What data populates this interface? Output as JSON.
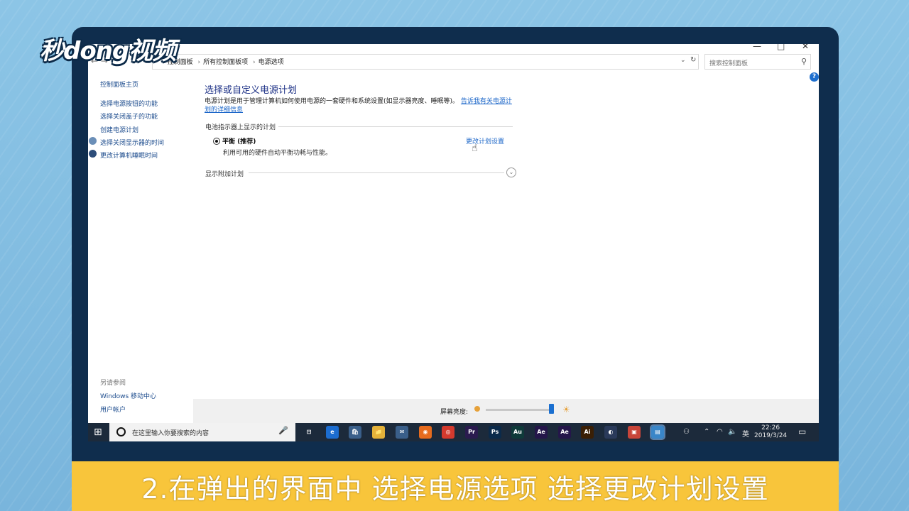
{
  "watermark": {
    "logo_text": "秒dong视频"
  },
  "window": {
    "controls": {
      "minimize": "—",
      "maximize": "□",
      "close": "✕"
    }
  },
  "addressbar": {
    "nav_arrows": "← → ↑",
    "breadcrumbs": [
      "控制面板",
      "所有控制面板项",
      "电源选项"
    ],
    "dropdown_icon": "chevron-down-icon",
    "refresh_icon": "refresh-icon",
    "search_placeholder": "搜索控制面板",
    "search_icon": "search-icon"
  },
  "leftpane": {
    "home": "控制面板主页",
    "links": [
      "选择电源按钮的功能",
      "选择关闭盖子的功能",
      "创建电源计划",
      "选择关闭显示器的时间",
      "更改计算机睡眠时间"
    ],
    "see_also_label": "另请参阅",
    "see_also_links": [
      "Windows 移动中心",
      "用户帐户"
    ]
  },
  "main": {
    "title": "选择或自定义电源计划",
    "description": "电源计划是用于管理计算机如何使用电源的一套硬件和系统设置(如显示器亮度、睡眠等)。",
    "description_link": "告诉我有关电源计划的详细信息",
    "battery_section_label": "电池指示器上显示的计划",
    "plan": {
      "name": "平衡 (推荐)",
      "description": "利用可用的硬件自动平衡功耗与性能。",
      "selected": true,
      "change_link": "更改计划设置"
    },
    "extra_plans_label": "显示附加计划"
  },
  "statusbar": {
    "brightness_label": "屏幕亮度:",
    "brightness_level_fraction": 0.98
  },
  "taskbar": {
    "search_placeholder": "在这里输入你要搜索的内容",
    "apps": [
      {
        "name": "task-view",
        "label": "⊟",
        "color": "#1c2a3b"
      },
      {
        "name": "edge",
        "label": "e",
        "color": "#1c6dd0"
      },
      {
        "name": "store",
        "label": "🛍",
        "color": "#3a5f8a"
      },
      {
        "name": "file-explorer",
        "label": "📁",
        "color": "#e4b23a"
      },
      {
        "name": "mail",
        "label": "✉",
        "color": "#3a5f8a"
      },
      {
        "name": "firefox",
        "label": "◉",
        "color": "#e66b1e"
      },
      {
        "name": "netease-music",
        "label": "◎",
        "color": "#d43a2e"
      },
      {
        "name": "premiere",
        "label": "Pr",
        "color": "#2a1b4f"
      },
      {
        "name": "photoshop",
        "label": "Ps",
        "color": "#0b2a4a"
      },
      {
        "name": "audition",
        "label": "Au",
        "color": "#0f3a3a"
      },
      {
        "name": "after-effects",
        "label": "Ae",
        "color": "#24164a"
      },
      {
        "name": "after-effects-2",
        "label": "Ae",
        "color": "#24164a"
      },
      {
        "name": "illustrator",
        "label": "Ai",
        "color": "#3a1f05"
      },
      {
        "name": "cinema4d",
        "label": "◐",
        "color": "#2a3a5a"
      },
      {
        "name": "app-red",
        "label": "▣",
        "color": "#c8453a"
      },
      {
        "name": "control-panel",
        "label": "▤",
        "color": "#3a86c8"
      }
    ],
    "tray_language": "英",
    "clock_time": "22:26",
    "clock_date": "2019/3/24"
  },
  "subtitle": "2.在弹出的界面中 选择电源选项 选择更改计划设置"
}
